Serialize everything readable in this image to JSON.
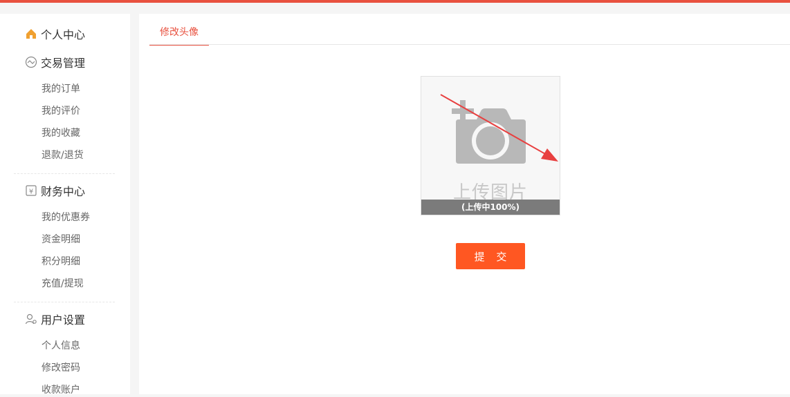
{
  "colors": {
    "accent": "#e8513f",
    "button": "#ff5722",
    "home_icon": "#f0a030"
  },
  "sidebar": {
    "sections": [
      {
        "icon": "home-icon",
        "label": "个人中心",
        "items": []
      },
      {
        "icon": "trade-icon",
        "label": "交易管理",
        "items": [
          "我的订单",
          "我的评价",
          "我的收藏",
          "退款/退货"
        ]
      },
      {
        "icon": "finance-icon",
        "label": "财务中心",
        "items": [
          "我的优惠券",
          "资金明细",
          "积分明细",
          "充值/提现"
        ]
      },
      {
        "icon": "user-settings-icon",
        "label": "用户设置",
        "items": [
          "个人信息",
          "修改密码",
          "收款账户"
        ]
      }
    ]
  },
  "main": {
    "tab_label": "修改头像",
    "upload": {
      "placeholder_text": "上传图片",
      "progress_text": "(上传中100%)",
      "progress": 1.0
    },
    "submit_label": "提 交"
  }
}
